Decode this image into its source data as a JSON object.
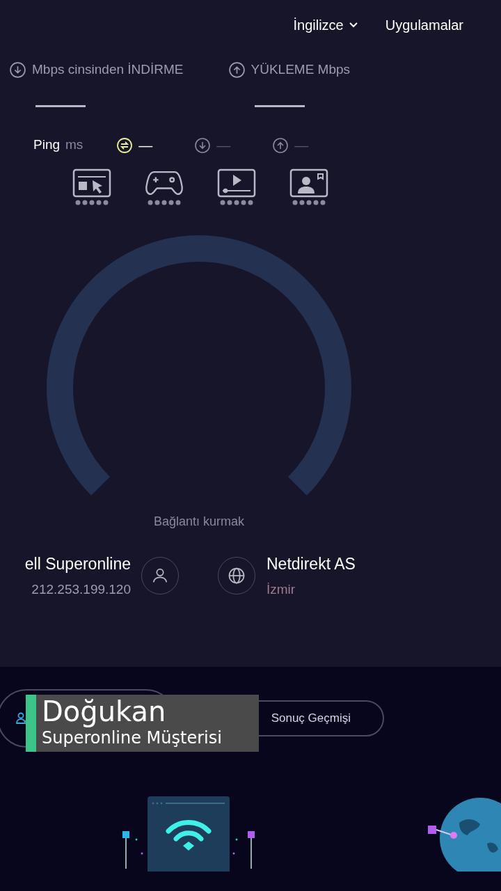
{
  "header": {
    "nav": [
      {
        "label": "İngilizce",
        "kind": "dropdown"
      },
      {
        "label": "Uygulamalar",
        "kind": "link"
      }
    ]
  },
  "speeds": [
    {
      "kind": "download",
      "label": "Mbps cinsinden İNDİRME"
    },
    {
      "kind": "upload",
      "label": "YÜKLEME Mbps"
    }
  ],
  "ping": {
    "label": "Ping",
    "unit": "ms",
    "values": [
      {
        "kind": "ping",
        "value": "—"
      },
      {
        "kind": "download",
        "value": "—"
      },
      {
        "kind": "upload",
        "value": "—"
      }
    ]
  },
  "activities": [
    {
      "kind": "browsing"
    },
    {
      "kind": "gaming"
    },
    {
      "kind": "video"
    },
    {
      "kind": "video_call"
    }
  ],
  "gauge": {
    "status": "Bağlantı kurmak"
  },
  "provider": {
    "name": "ell Superonline",
    "ip": "212.253.199.120"
  },
  "server": {
    "name": "Netdirekt AS",
    "location": "İzmir"
  },
  "buttons": [
    {
      "kind": "create_account"
    },
    {
      "kind": "history",
      "label": "Sonuç Geçmişi"
    }
  ],
  "caption": {
    "name": "Doğukan",
    "subtitle": "Superonline Müşterisi"
  }
}
